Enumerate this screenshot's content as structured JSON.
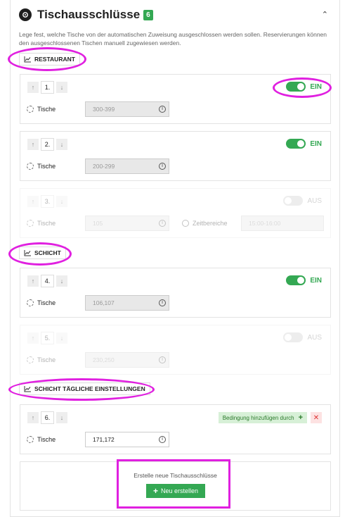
{
  "header": {
    "title": "Tischausschlüsse",
    "count": "6",
    "collapse_icon": "chevron-up-icon"
  },
  "description": "Lege fest, welche Tische von der automatischen Zuweisung ausgeschlossen werden sollen. Reservierungen können den ausgeschlossenen Tischen manuell zugewiesen werden.",
  "sections": {
    "restaurant": "RESTAURANT",
    "schicht": "SCHICHT",
    "schicht_daily": "SCHICHT TÄGLICHE EINSTELLUNGEN"
  },
  "labels": {
    "tables": "Tische",
    "time_ranges": "Zeitbereiche",
    "on": "EIN",
    "off": "AUS"
  },
  "rules": [
    {
      "number": "1.",
      "tables": "300-399",
      "status": "EIN"
    },
    {
      "number": "2.",
      "tables": "200-299",
      "status": "EIN"
    },
    {
      "number": "3.",
      "tables": "105",
      "status": "AUS",
      "time_range": "15:00-16:00"
    },
    {
      "number": "4.",
      "tables": "106,107",
      "status": "EIN"
    },
    {
      "number": "5.",
      "tables": "230,250",
      "status": "AUS"
    },
    {
      "number": "6.",
      "tables": "171,172",
      "condition_label": "Bedingung hinzufügen durch"
    }
  ],
  "create": {
    "prompt": "Erstelle neue Tischausschlüsse",
    "button_label": "Neu erstellen"
  },
  "colors": {
    "accent_green": "#34a853",
    "highlight": "#e020e0",
    "delete_red": "#dd3333"
  }
}
